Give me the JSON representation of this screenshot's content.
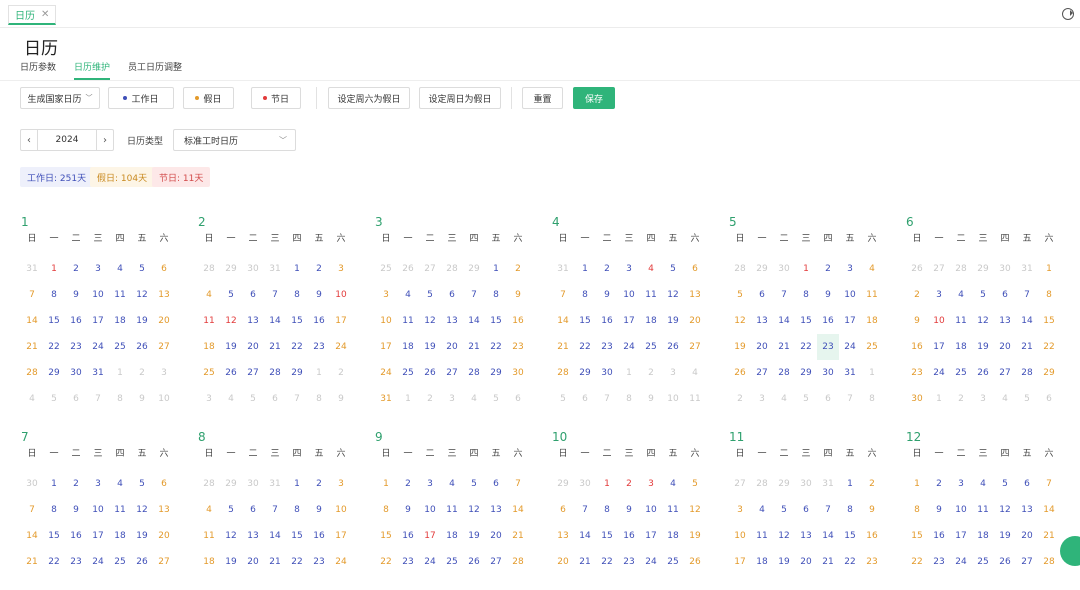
{
  "tab": {
    "label": "日历"
  },
  "page_title": "日历",
  "subtabs": [
    "日历参数",
    "日历维护",
    "员工日历调整"
  ],
  "toolbar": {
    "generate": "生成国家日历",
    "workday": "工作日",
    "restday": "假日",
    "holiday": "节日",
    "set_sat": "设定周六为假日",
    "set_sun": "设定周日为假日",
    "reset": "重置",
    "save": "保存"
  },
  "filters": {
    "year": "2024",
    "type_label": "日历类型",
    "type_value": "标准工时日历"
  },
  "summary": {
    "workdays": "工作日: 251天",
    "restdays": "假日: 104天",
    "holidays": "节日: 11天"
  },
  "weekdays": [
    "日",
    "一",
    "二",
    "三",
    "四",
    "五",
    "六"
  ],
  "colors": {
    "accent": "#2fb47a",
    "work": "#3f4fb8",
    "rest": "#e39a2b",
    "holiday": "#e23b3b",
    "other": "#c9c9c9"
  },
  "months": [
    {
      "label": "1",
      "start": 1,
      "days": 31,
      "prevDays": 31
    },
    {
      "label": "2",
      "start": 4,
      "days": 29,
      "prevDays": 31
    },
    {
      "label": "3",
      "start": 5,
      "days": 31,
      "prevDays": 29
    },
    {
      "label": "4",
      "start": 1,
      "days": 30,
      "prevDays": 31
    },
    {
      "label": "5",
      "start": 3,
      "days": 31,
      "prevDays": 30
    },
    {
      "label": "6",
      "start": 6,
      "days": 30,
      "prevDays": 31
    },
    {
      "label": "7",
      "start": 1,
      "days": 31,
      "prevDays": 30
    },
    {
      "label": "8",
      "start": 4,
      "days": 31,
      "prevDays": 31
    },
    {
      "label": "9",
      "start": 0,
      "days": 30,
      "prevDays": 31
    },
    {
      "label": "10",
      "start": 2,
      "days": 31,
      "prevDays": 30
    },
    {
      "label": "11",
      "start": 5,
      "days": 30,
      "prevDays": 31
    },
    {
      "label": "12",
      "start": 0,
      "days": 31,
      "prevDays": 30
    }
  ],
  "holidays": {
    "1": [
      1
    ],
    "2": [
      10,
      11,
      12
    ],
    "4": [
      4
    ],
    "5": [
      1
    ],
    "6": [
      10
    ],
    "9": [
      17
    ],
    "10": [
      1,
      2,
      3
    ]
  },
  "highlighted_day": {
    "month": 5,
    "day": 23
  }
}
